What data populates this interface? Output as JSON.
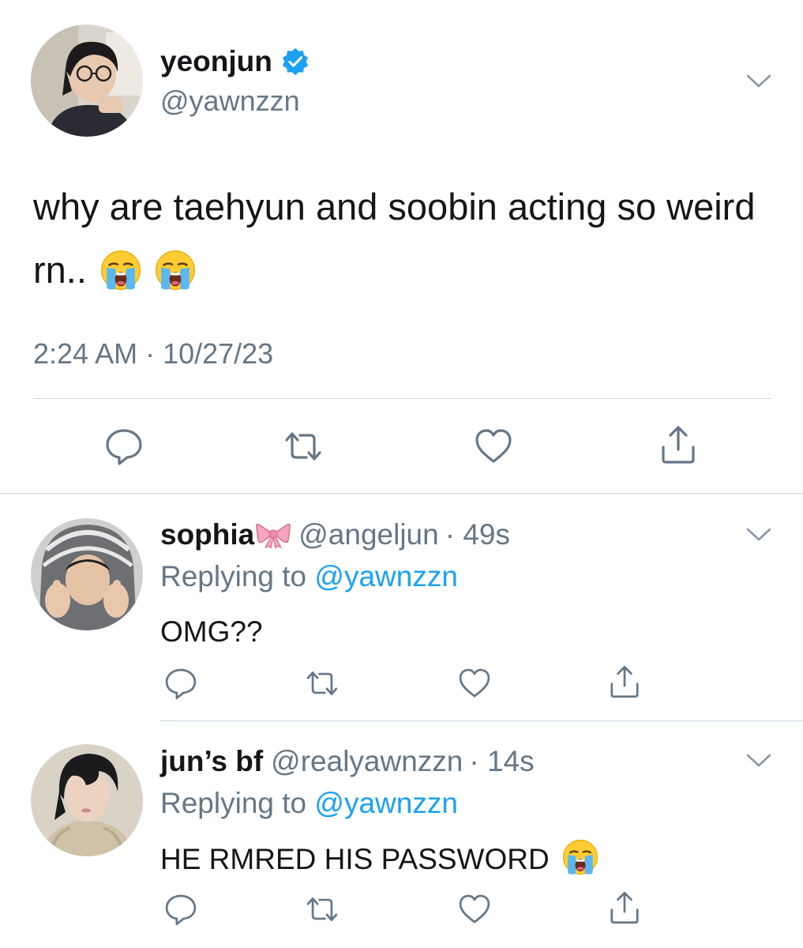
{
  "main_tweet": {
    "author_name": "yeonjun",
    "author_handle": "@yawnzzn",
    "text": "why are taehyun and soobin acting so weird rn..",
    "emojis": [
      "loudly-crying-face",
      "loudly-crying-face"
    ],
    "timestamp": "2:24 AM · 10/27/23",
    "verified": true,
    "actions": [
      "reply-icon",
      "retweet-icon",
      "like-icon",
      "share-icon"
    ]
  },
  "replies": [
    {
      "author_name": "sophia",
      "name_emoji": "ribbon",
      "author_handle": "@angeljun",
      "time": "· 49s",
      "replying_prefix": "Replying to",
      "replying_to": "@yawnzzn",
      "text": "OMG??"
    },
    {
      "author_name": "jun’s bf",
      "author_handle": "@realyawnzzn",
      "time": "· 14s",
      "replying_prefix": "Replying to",
      "replying_to": "@yawnzzn",
      "text": "HE RMRED HIS PASSWORD",
      "text_emoji": "loudly-crying-face"
    }
  ],
  "colors": {
    "link_blue": "#1da1f2",
    "secondary_gray": "#657786",
    "icon_gray": "#657786",
    "divider": "#ccd6dd"
  }
}
